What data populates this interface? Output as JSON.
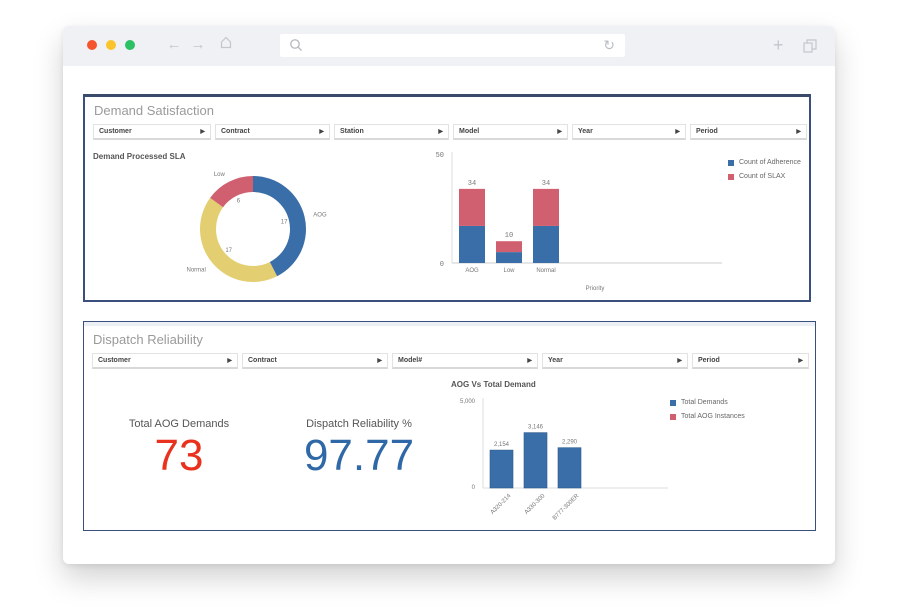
{
  "browser": {
    "nav_icons": [
      "back-arrow-icon",
      "forward-arrow-icon",
      "home-icon"
    ],
    "address_value": "",
    "right_icons": [
      "new-tab-plus-icon",
      "tabs-overview-icon"
    ]
  },
  "colors": {
    "blue": "#3a6ea8",
    "red": "#d0606f",
    "yellow": "#e3cf72",
    "kpi_red": "#e8321e",
    "kpi_blue": "#2f68a6"
  },
  "demand_satisfaction": {
    "title": "Demand Satisfaction",
    "filters": [
      "Customer",
      "Contract",
      "Station",
      "Model",
      "Year",
      "Period"
    ],
    "donut_title": "Demand Processed SLA"
  },
  "dispatch_reliability": {
    "title": "Dispatch Reliability",
    "filters": [
      "Customer",
      "Contract",
      "Model#",
      "Year",
      "Period"
    ],
    "kpis": [
      {
        "label": "Total AOG Demands",
        "value": "73"
      },
      {
        "label": "Dispatch Reliability %",
        "value": "97.77"
      }
    ]
  },
  "chart_data": [
    {
      "type": "pie",
      "variant": "donut",
      "title": "Demand Processed SLA",
      "categories": [
        "AOG",
        "Low",
        "Normal"
      ],
      "values": [
        17,
        6,
        17
      ],
      "colors": [
        "#3a6ea8",
        "#d0606f",
        "#e3cf72"
      ]
    },
    {
      "type": "bar",
      "stacked": true,
      "title": "",
      "categories": [
        "AOG",
        "Low",
        "Normal"
      ],
      "series": [
        {
          "name": "Count of Adherence",
          "values": [
            17,
            5,
            17
          ],
          "color": "#3a6ea8"
        },
        {
          "name": "Count of SLAX",
          "values": [
            17,
            5,
            17
          ],
          "color": "#d0606f"
        }
      ],
      "totals": [
        34,
        10,
        34
      ],
      "xlabel": "Priority",
      "ylabel": "",
      "ylim": [
        0,
        50
      ],
      "yticks": [
        0,
        50
      ],
      "legend": "top-right"
    },
    {
      "type": "bar",
      "title": "AOG Vs Total Demand",
      "categories": [
        "A320-214",
        "A330-300",
        "B777-300ER"
      ],
      "series": [
        {
          "name": "Total Demands",
          "values": [
            2154,
            3146,
            2290
          ],
          "color": "#3a6ea8"
        },
        {
          "name": "Total AOG Instances",
          "values": [
            null,
            null,
            null
          ],
          "color": "#d0606f"
        }
      ],
      "data_labels": [
        "2,154",
        "3,146",
        "2,290"
      ],
      "xlabel": "",
      "ylabel": "",
      "ylim": [
        0,
        5000
      ],
      "yticks": [
        "0",
        "5,000"
      ],
      "legend": "top-right"
    }
  ]
}
